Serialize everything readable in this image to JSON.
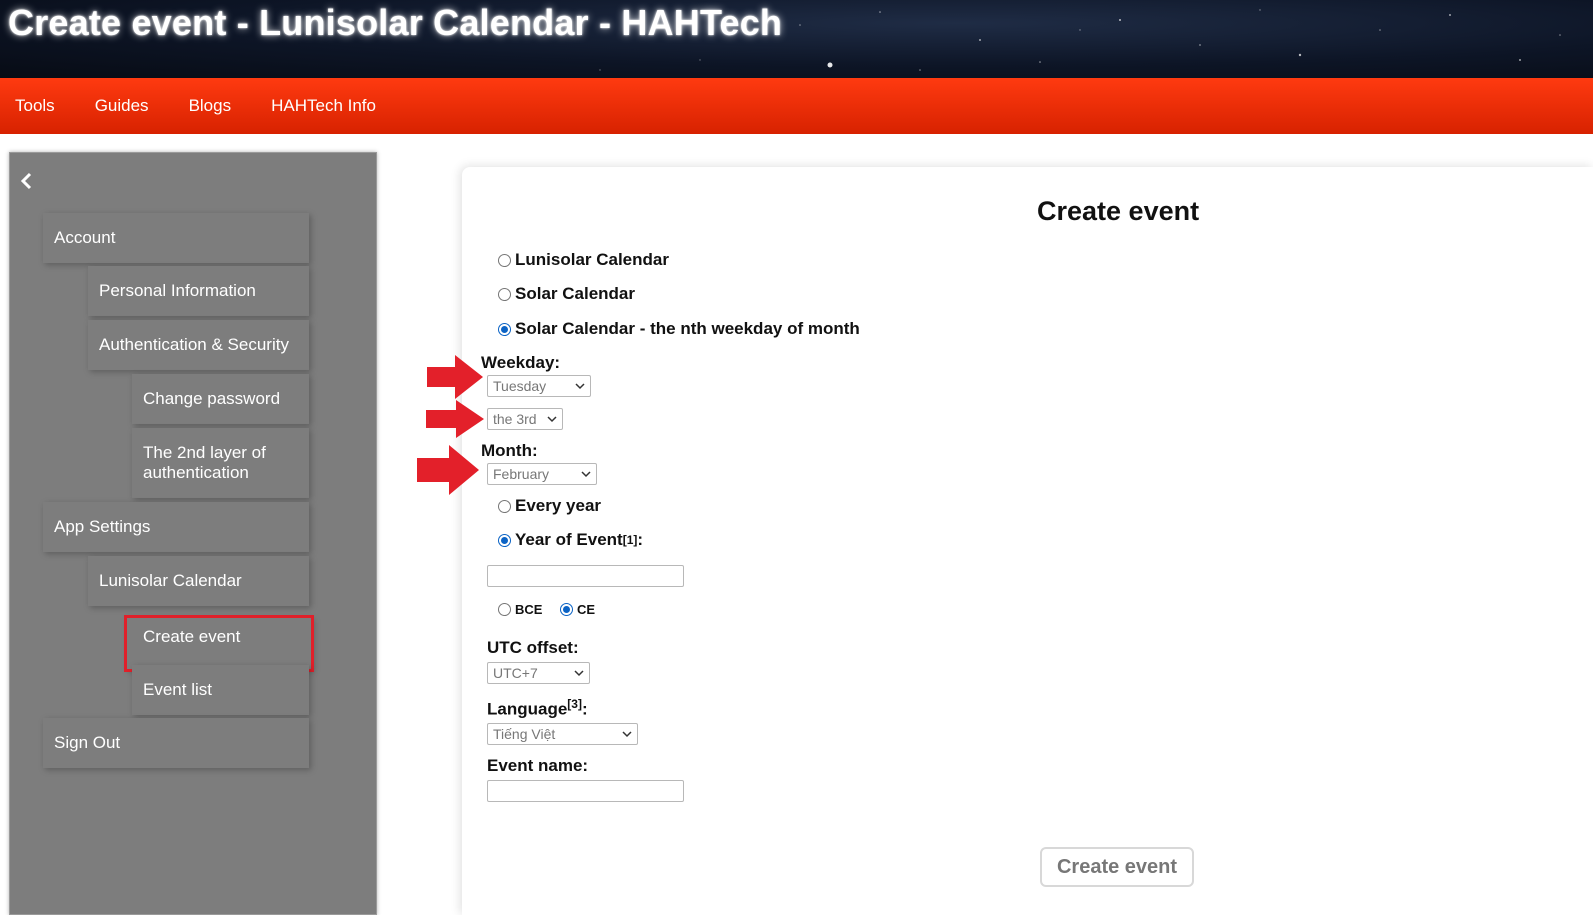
{
  "header": {
    "title": "Create event - Lunisolar Calendar - HAHTech"
  },
  "nav": {
    "items": [
      "Tools",
      "Guides",
      "Blogs",
      "HAHTech Info"
    ]
  },
  "sidebar": {
    "collapse_icon": "chevron-left-icon",
    "items": {
      "account": "Account",
      "personal_info": "Personal Information",
      "auth_security": "Authentication & Security",
      "change_password": "Change password",
      "second_layer": "The 2nd layer of authentication",
      "app_settings": "App Settings",
      "lunisolar_calendar": "Lunisolar Calendar",
      "create_event": "Create event",
      "event_list": "Event list",
      "sign_out": "Sign Out"
    }
  },
  "form": {
    "title": "Create event",
    "calendar_options": [
      {
        "label": "Lunisolar Calendar",
        "checked": false
      },
      {
        "label": "Solar Calendar",
        "checked": false
      },
      {
        "label": "Solar Calendar - the nth weekday of month",
        "checked": true
      }
    ],
    "weekday_label": "Weekday:",
    "weekday_value": "Tuesday",
    "nth_value": "the 3rd",
    "month_label": "Month:",
    "month_value": "February",
    "every_year_label": "Every year",
    "year_of_event_label": "Year of Event",
    "year_of_event_sup": "[1]",
    "year_value": "",
    "era_bce": "BCE",
    "era_ce": "CE",
    "utc_label": "UTC offset:",
    "utc_value": "UTC+7",
    "language_label": "Language",
    "language_sup": "[3]",
    "language_value": "Tiếng Việt",
    "event_name_label": "Event name:",
    "event_name_value": "",
    "submit_label": "Create event"
  },
  "colors": {
    "nav": "#e52b00",
    "sidebar": "#7d7d7d",
    "highlight": "#e0202a",
    "radio": "#0b63c5",
    "arrow": "#e3202a"
  }
}
